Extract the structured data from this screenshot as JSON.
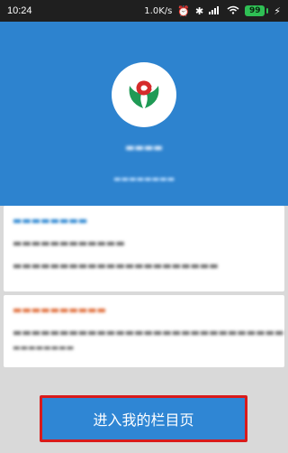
{
  "status_bar": {
    "time": "10:24",
    "network_speed": "1.0K/s",
    "battery_level": "99",
    "icons": [
      "alarm-icon",
      "bluetooth-icon",
      "signal-icon",
      "wifi-icon",
      "battery-icon",
      "bolt-icon"
    ]
  },
  "colors": {
    "hero_blue": "#2d83cf",
    "button_blue": "#2f86d4",
    "highlight_red": "#d91b1b",
    "battery_green": "#2fbf54"
  },
  "logo": {
    "icon": "bank-logo-icon"
  },
  "main": {
    "enter_button_label": "进入我的栏目页"
  }
}
